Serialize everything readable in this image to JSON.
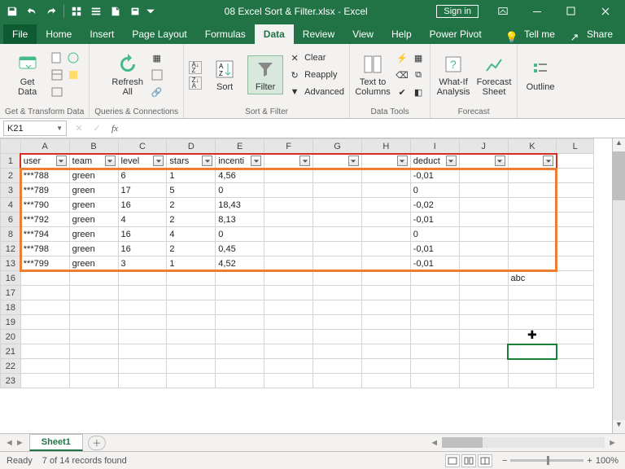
{
  "titlebar": {
    "filename": "08 Excel Sort & Filter.xlsx",
    "appname": "Excel",
    "signin": "Sign in"
  },
  "tabs": {
    "file": "File",
    "home": "Home",
    "insert": "Insert",
    "pagelayout": "Page Layout",
    "formulas": "Formulas",
    "data": "Data",
    "review": "Review",
    "view": "View",
    "help": "Help",
    "powerpivot": "Power Pivot",
    "tellme": "Tell me",
    "share": "Share"
  },
  "ribbon": {
    "group1": "Get & Transform Data",
    "getdata": "Get\nData",
    "group2": "Queries & Connections",
    "refresh": "Refresh\nAll",
    "group3": "Sort & Filter",
    "sort": "Sort",
    "filter": "Filter",
    "clear": "Clear",
    "reapply": "Reapply",
    "advanced": "Advanced",
    "group4": "Data Tools",
    "ttc": "Text to\nColumns",
    "group5": "Forecast",
    "whatif": "What-If\nAnalysis",
    "forecast": "Forecast\nSheet",
    "group6": "",
    "outline": "Outline"
  },
  "namebox": "K21",
  "columns": [
    "A",
    "B",
    "C",
    "D",
    "E",
    "F",
    "G",
    "H",
    "I",
    "J",
    "K",
    "L"
  ],
  "headers": {
    "A": "user",
    "B": "team",
    "C": "level",
    "D": "stars",
    "E": "incenti",
    "F": "",
    "G": "",
    "H": "",
    "I": "deduct",
    "J": "",
    "K": ""
  },
  "vis_rows": [
    2,
    3,
    4,
    6,
    8,
    12,
    13,
    16,
    17,
    18,
    19,
    20,
    21,
    22,
    23
  ],
  "data": {
    "2": {
      "A": "***788",
      "B": "green",
      "C": "6",
      "D": "1",
      "E": "4,56",
      "I": "-0,01"
    },
    "3": {
      "A": "***789",
      "B": "green",
      "C": "17",
      "D": "5",
      "E": "0",
      "I": "0"
    },
    "4": {
      "A": "***790",
      "B": "green",
      "C": "16",
      "D": "2",
      "E": "18,43",
      "I": "-0,02"
    },
    "6": {
      "A": "***792",
      "B": "green",
      "C": "4",
      "D": "2",
      "E": "8,13",
      "I": "-0,01"
    },
    "8": {
      "A": "***794",
      "B": "green",
      "C": "16",
      "D": "4",
      "E": "0",
      "I": "0"
    },
    "12": {
      "A": "***798",
      "B": "green",
      "C": "16",
      "D": "2",
      "E": "0,45",
      "I": "-0,01"
    },
    "13": {
      "A": "***799",
      "B": "green",
      "C": "3",
      "D": "1",
      "E": "4,52",
      "I": "-0,01"
    },
    "16": {
      "K": "abc"
    }
  },
  "active_cell": "K21",
  "sheetname": "Sheet1",
  "status": {
    "ready": "Ready",
    "records": "7 of 14 records found",
    "zoom": "100%"
  }
}
